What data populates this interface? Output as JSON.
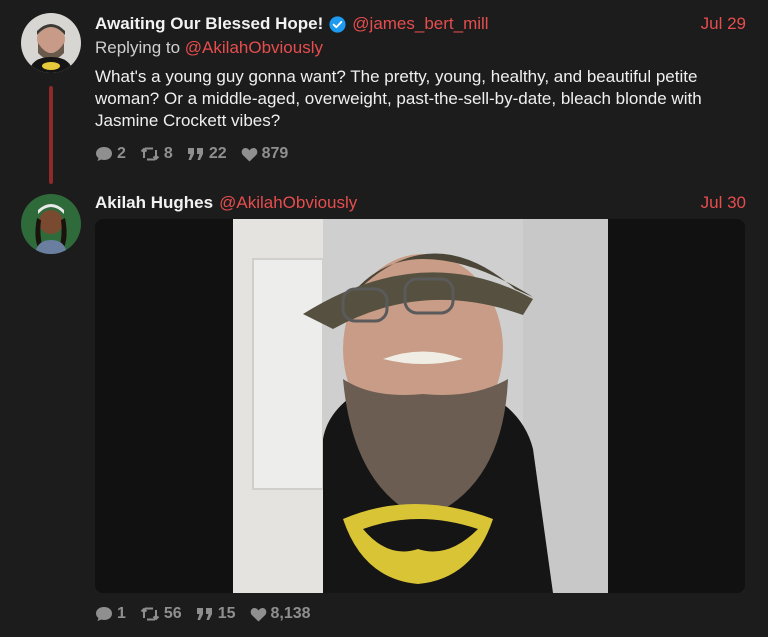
{
  "tweets": [
    {
      "display_name": "Awaiting Our Blessed Hope!",
      "handle": "@james_bert_mill",
      "date": "Jul 29",
      "replying_prefix": "Replying to",
      "replying_to": "@AkilahObviously",
      "text": "What's a young guy gonna want? The pretty, young, healthy, and beautiful petite woman? Or a middle-aged, overweight, past-the-sell-by-date, bleach blonde with Jasmine Crockett vibes?",
      "stats": {
        "replies": "2",
        "retweets": "8",
        "quotes": "22",
        "likes": "879"
      }
    },
    {
      "display_name": "Akilah Hughes",
      "handle": "@AkilahObviously",
      "date": "Jul 30",
      "stats": {
        "replies": "1",
        "retweets": "56",
        "quotes": "15",
        "likes": "8,138"
      }
    }
  ],
  "icons": {
    "verified": "verified-badge-icon",
    "reply": "speech-bubble-icon",
    "retweet": "retweet-icon",
    "quote": "quote-icon",
    "like": "heart-icon"
  },
  "colors": {
    "background": "#1c1c1d",
    "accent": "#e64d4d",
    "thread_line": "#8e2a2a",
    "muted": "#8f8f8f",
    "verified": "#1d9bf0"
  }
}
